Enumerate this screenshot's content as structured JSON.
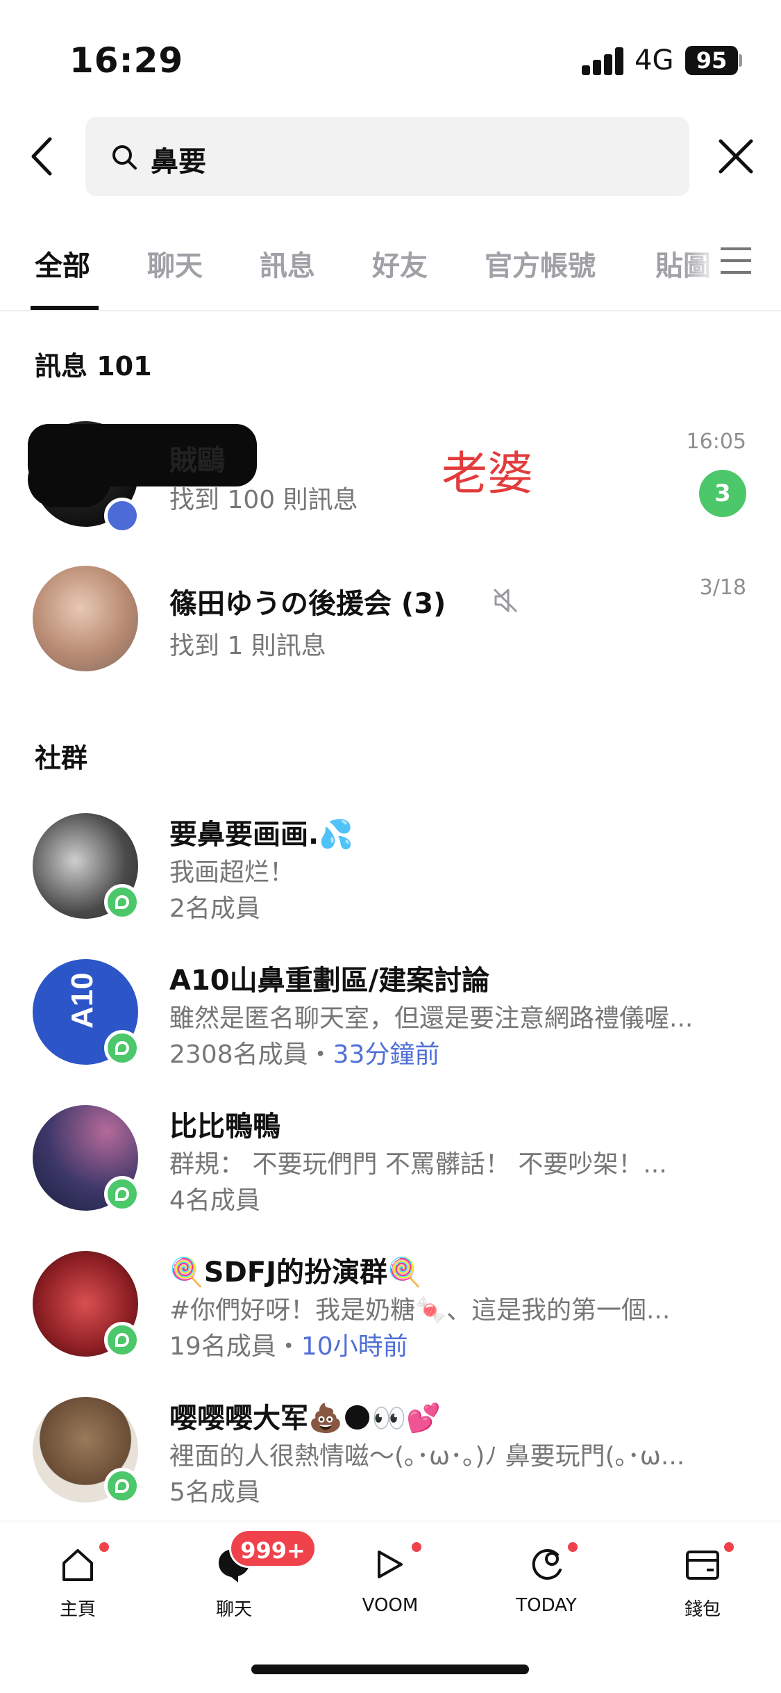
{
  "status_bar": {
    "time": "16:29",
    "network": "4G",
    "battery": "95"
  },
  "search": {
    "query": "鼻要"
  },
  "tabs": [
    {
      "label": "全部",
      "active": true
    },
    {
      "label": "聊天",
      "active": false
    },
    {
      "label": "訊息",
      "active": false
    },
    {
      "label": "好友",
      "active": false
    },
    {
      "label": "官方帳號",
      "active": false
    },
    {
      "label": "貼圖",
      "active": false
    }
  ],
  "messages_section": {
    "title": "訊息 101",
    "items": [
      {
        "name": "賊鷗",
        "subtitle": "找到 100 則訊息",
        "time": "16:05",
        "unread": "3"
      },
      {
        "name": "篠田ゆうの後援会 (3)",
        "subtitle": "找到 1 則訊息",
        "time": "3/18",
        "muted": true
      }
    ],
    "annotation": "老婆"
  },
  "community_section": {
    "title": "社群",
    "items": [
      {
        "name": "要鼻要画画.💦",
        "description": "我画超烂！",
        "members": "2名成員",
        "recent": ""
      },
      {
        "name": "A10山鼻重劃區/建案討論",
        "description": "雖然是匿名聊天室，但還是要注意網路禮儀喔...",
        "members": "2308名成員・",
        "recent": "33分鐘前"
      },
      {
        "name": "比比鴨鴨",
        "description": "群規： 不要玩們門 不罵髒話！ 不要吵架！...",
        "members": "4名成員",
        "recent": ""
      },
      {
        "name": "🍭SDFJ的扮演群🍭",
        "description": "#你們好呀！我是奶糖🍬、這是我的第一個...",
        "members": "19名成員・",
        "recent": "10小時前"
      },
      {
        "name": "嘤嘤嘤大军💩🌑👀💕",
        "description": "裡面的人很熱情嗞～(｡･ω･｡)ﾉ 鼻要玩門(｡･ω...",
        "members": "5名成員",
        "recent": ""
      }
    ]
  },
  "tab_bar": {
    "items": [
      {
        "label": "主頁",
        "icon": "home-icon",
        "dot": true
      },
      {
        "label": "聊天",
        "icon": "chat-icon",
        "badge": "999+"
      },
      {
        "label": "VOOM",
        "icon": "voom-icon",
        "dot": true
      },
      {
        "label": "TODAY",
        "icon": "today-icon",
        "dot": true
      },
      {
        "label": "錢包",
        "icon": "wallet-icon",
        "dot": true
      }
    ]
  },
  "colors": {
    "accent_green": "#4cc76a",
    "badge_red": "#f0424b",
    "link_blue": "#4f6fd8",
    "annotation_red": "#e33b3b"
  }
}
